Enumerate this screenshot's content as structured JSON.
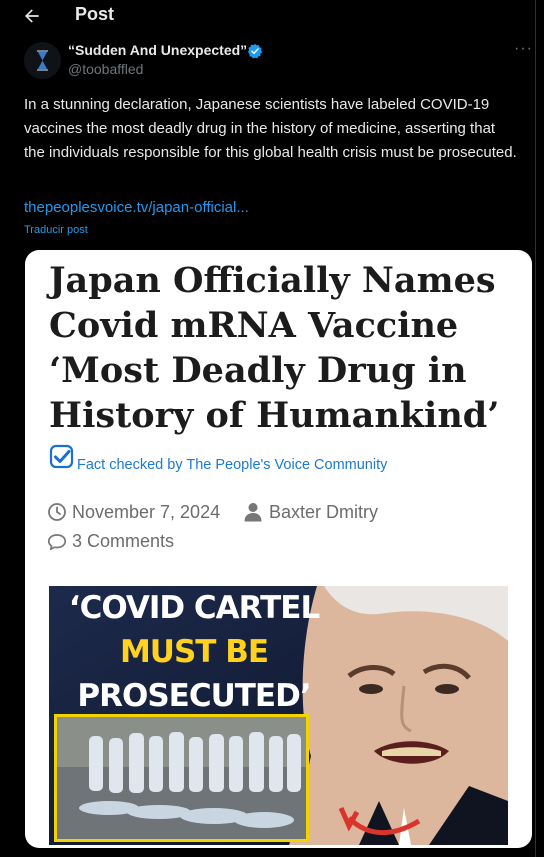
{
  "header": {
    "title": "Post",
    "back_icon": "arrow-left-icon"
  },
  "author": {
    "name": "“Sudden And Unexpected”",
    "handle": "@toobaffled",
    "verified_icon": "verified-badge-icon",
    "more_label": "···"
  },
  "post": {
    "text": "In a stunning declaration, Japanese scientists have labeled COVID-19 vaccines the most deadly drug in the history of medicine, asserting that the individuals responsible for this global health crisis must be prosecuted.",
    "link": "thepeoplesvoice.tv/japan-official...",
    "translate": "Traducir post"
  },
  "card": {
    "headline": "Japan Officially Names Covid mRNA Vaccine ‘Most Deadly Drug in History of Humankind’",
    "fact_check": "Fact checked by The People's Voice Community",
    "date": "November 7, 2024",
    "author": "Baxter Dmitry",
    "comments": "3 Comments",
    "image": {
      "line1": "‘COVID CARTEL",
      "line2": "MUST BE",
      "line3": "PROSECUTED’"
    }
  },
  "colors": {
    "accent": "#1d9bf0",
    "background": "#000000",
    "headline_yellow": "#ffd21f"
  }
}
